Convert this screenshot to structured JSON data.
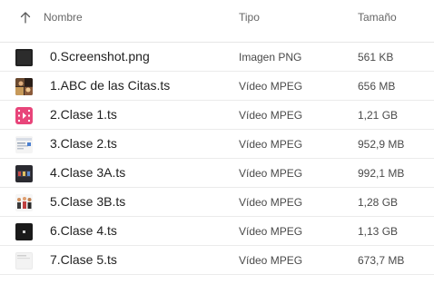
{
  "header": {
    "name_label": "Nombre",
    "type_label": "Tipo",
    "size_label": "Tamaño",
    "sort_icon": "arrow-up-icon"
  },
  "files": [
    {
      "name": "0.Screenshot.png",
      "type": "Imagen PNG",
      "size": "561 KB"
    },
    {
      "name": "1.ABC de las Citas.ts",
      "type": "Vídeo MPEG",
      "size": "656 MB"
    },
    {
      "name": "2.Clase 1.ts",
      "type": "Vídeo MPEG",
      "size": "1,21 GB"
    },
    {
      "name": "3.Clase 2.ts",
      "type": "Vídeo MPEG",
      "size": "952,9 MB"
    },
    {
      "name": "4.Clase 3A.ts",
      "type": "Vídeo MPEG",
      "size": "992,1 MB"
    },
    {
      "name": "5.Clase 3B.ts",
      "type": "Vídeo MPEG",
      "size": "1,28 GB"
    },
    {
      "name": "6.Clase 4.ts",
      "type": "Vídeo MPEG",
      "size": "1,13 GB"
    },
    {
      "name": "7.Clase 5.ts",
      "type": "Vídeo MPEG",
      "size": "673,7 MB"
    }
  ]
}
